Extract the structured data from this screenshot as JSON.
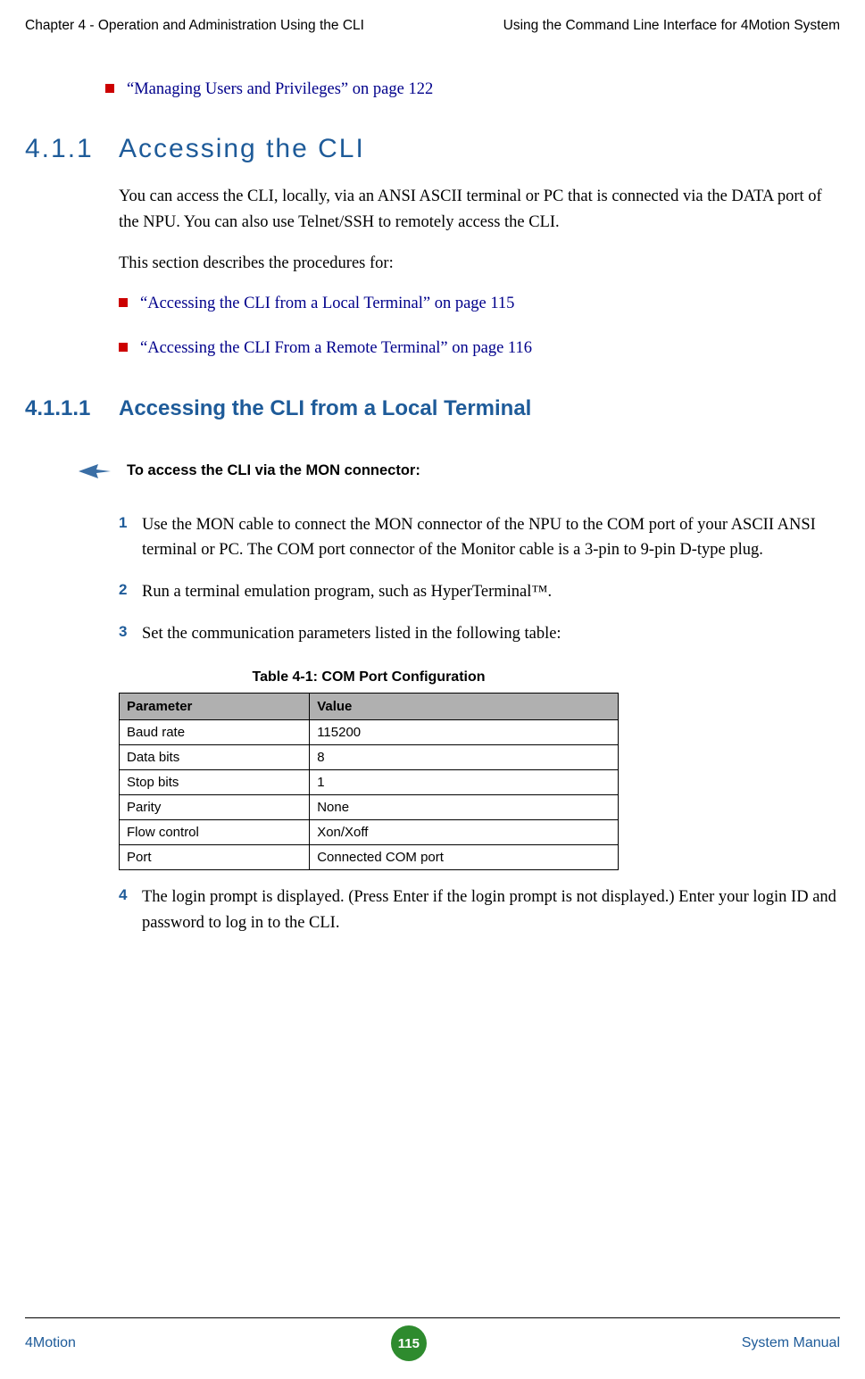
{
  "header": {
    "left": "Chapter 4 - Operation and Administration Using the CLI",
    "right": "Using the Command Line Interface for 4Motion System"
  },
  "top_bullet": "“Managing Users and Privileges” on page 122",
  "section": {
    "number": "4.1.1",
    "title": "Accessing the CLI",
    "para1": "You can access the CLI, locally, via an ANSI ASCII terminal or PC that is connected via the DATA port of the NPU. You can also use Telnet/SSH to remotely access the CLI.",
    "para2": "This section describes the procedures for:",
    "bullets": [
      "“Accessing the CLI from a Local Terminal” on page 115",
      "“Accessing the CLI From a Remote Terminal” on page 116"
    ]
  },
  "subsection": {
    "number": "4.1.1.1",
    "title": "Accessing the CLI from a Local Terminal",
    "callout": "To access the CLI via the MON connector:",
    "steps": [
      "Use the MON cable to connect the MON connector of the NPU to the COM port of your ASCII ANSI terminal or PC. The COM port connector of the Monitor cable is a 3-pin to 9-pin D-type plug.",
      "Run a terminal emulation program, such as HyperTerminal™.",
      "Set the communication parameters listed in the following table:"
    ],
    "step4": "The login prompt is displayed. (Press Enter if the login prompt is not displayed.) Enter your login ID and password to log in to the CLI."
  },
  "chart_data": {
    "type": "table",
    "title": "Table 4-1: COM Port Configuration",
    "columns": [
      "Parameter",
      "Value"
    ],
    "rows": [
      [
        "Baud rate",
        "115200"
      ],
      [
        "Data bits",
        "8"
      ],
      [
        "Stop bits",
        "1"
      ],
      [
        "Parity",
        "None"
      ],
      [
        "Flow control",
        "Xon/Xoff"
      ],
      [
        "Port",
        "Connected COM port"
      ]
    ]
  },
  "footer": {
    "left": "4Motion",
    "page": "115",
    "right": "System Manual"
  }
}
